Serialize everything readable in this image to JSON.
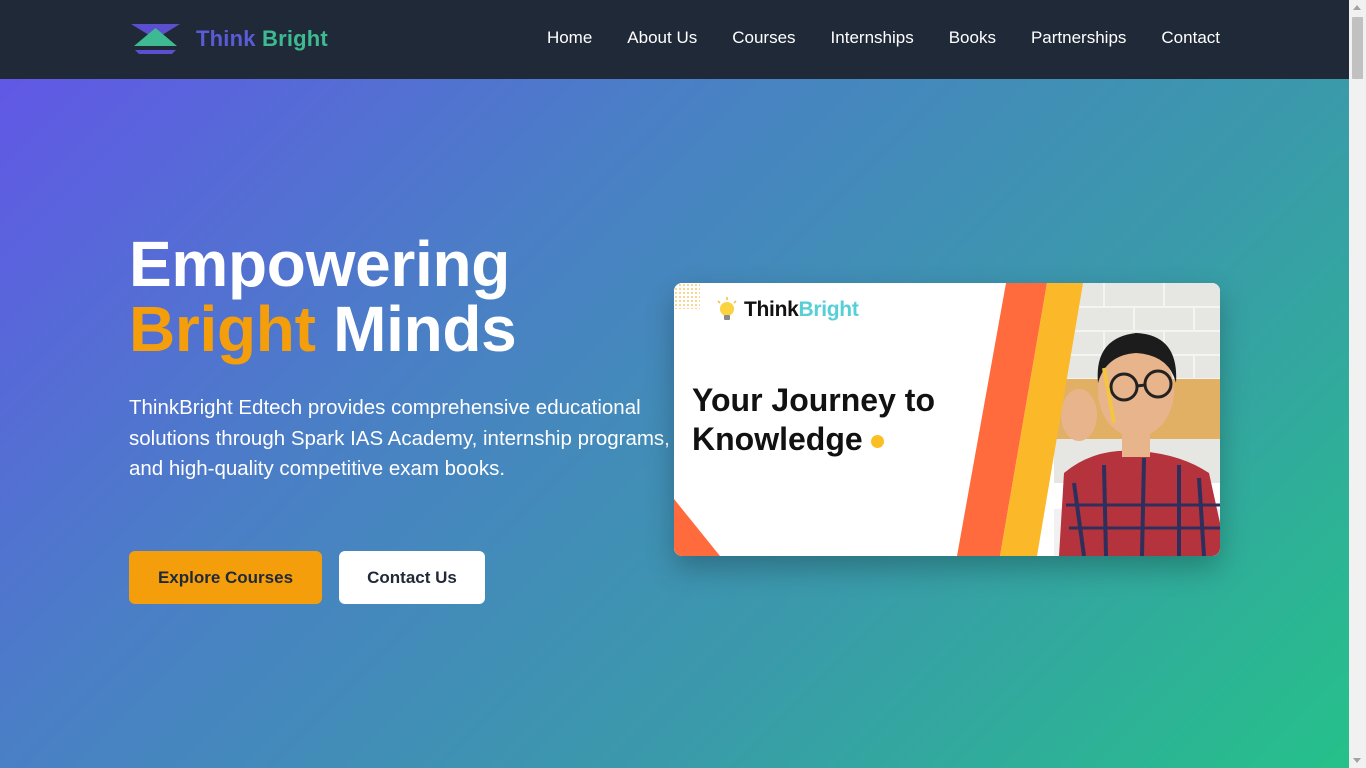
{
  "brand": {
    "think": "Think",
    "bright": "Bright"
  },
  "nav": {
    "items": [
      "Home",
      "About Us",
      "Courses",
      "Internships",
      "Books",
      "Partnerships",
      "Contact"
    ]
  },
  "hero": {
    "title_line1": "Empowering",
    "title_accent": "Bright",
    "title_rest": "Minds",
    "description": "ThinkBright Edtech provides comprehensive educational solutions through Spark IAS Academy, internship programs, and high-quality competitive exam books.",
    "primary_button": "Explore Courses",
    "secondary_button": "Contact Us"
  },
  "card": {
    "brand_think": "Think",
    "brand_bright": "Bright",
    "heading_line1": "Your Journey to",
    "heading_line2": "Knowledge"
  },
  "colors": {
    "nav_bg": "#1f2937",
    "accent": "#f59e0b",
    "brand_think": "#5b5bd6",
    "brand_bright": "#3dba91",
    "gradient_start": "#6158e6",
    "gradient_end": "#25c18a"
  }
}
